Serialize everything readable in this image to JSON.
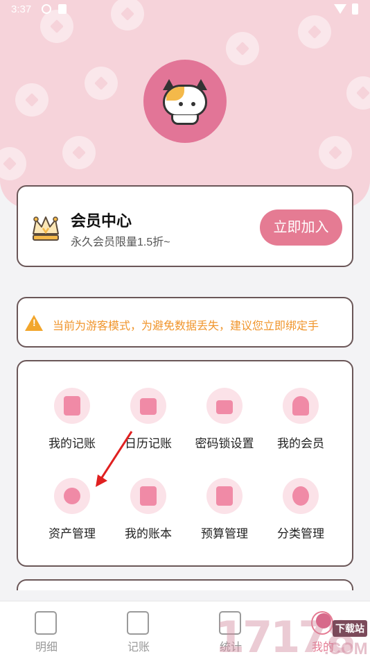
{
  "status_bar": {
    "time": "3:37"
  },
  "vip": {
    "title": "会员中心",
    "subtitle": "永久会员限量1.5折~",
    "join_label": "立即加入"
  },
  "notice": {
    "text": "当前为游客模式，为避免数据丢失，建议您立即绑定手"
  },
  "menu": {
    "items": [
      {
        "label": "我的记账",
        "icon": "ledger-icon"
      },
      {
        "label": "日历记账",
        "icon": "calendar-icon"
      },
      {
        "label": "密码锁设置",
        "icon": "lock-icon"
      },
      {
        "label": "我的会员",
        "icon": "member-icon"
      },
      {
        "label": "资产管理",
        "icon": "yen-coin-icon"
      },
      {
        "label": "我的账本",
        "icon": "clipboard-icon"
      },
      {
        "label": "预算管理",
        "icon": "budget-chart-icon"
      },
      {
        "label": "分类管理",
        "icon": "category-icon"
      }
    ]
  },
  "tabs": [
    {
      "label": "明细",
      "icon": "receipt-search-icon"
    },
    {
      "label": "记账",
      "icon": "notebook-icon"
    },
    {
      "label": "统计",
      "icon": "stats-icon"
    },
    {
      "label": "我的",
      "icon": "profile-icon"
    }
  ],
  "watermark": {
    "big": "17178",
    "small": "下载站",
    "com": ".COM"
  },
  "colors": {
    "header_pink": "#f6d3da",
    "accent_pink": "#e57b93",
    "icon_bg": "#fbe2e8",
    "warning_orange": "#f0952c",
    "arrow_red": "#e02020"
  }
}
